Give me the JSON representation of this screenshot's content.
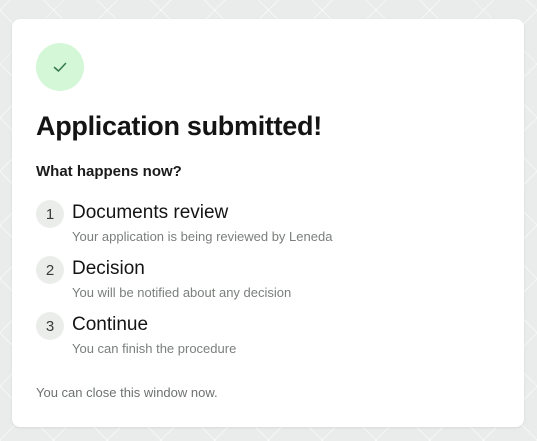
{
  "card": {
    "status_icon": "check-icon",
    "title": "Application submitted!",
    "subtitle": "What happens now?",
    "steps": [
      {
        "number": "1",
        "title": "Documents review",
        "description": "Your application is being reviewed by Leneda"
      },
      {
        "number": "2",
        "title": "Decision",
        "description": "You will be notified about any decision"
      },
      {
        "number": "3",
        "title": "Continue",
        "description": "You can finish the procedure"
      }
    ],
    "footer_note": "You can close this window now."
  },
  "colors": {
    "success_bg": "#d3f7d7",
    "success_check": "#3a7a50",
    "step_badge_bg": "#ebedeb",
    "page_bg": "#e9ecea"
  }
}
